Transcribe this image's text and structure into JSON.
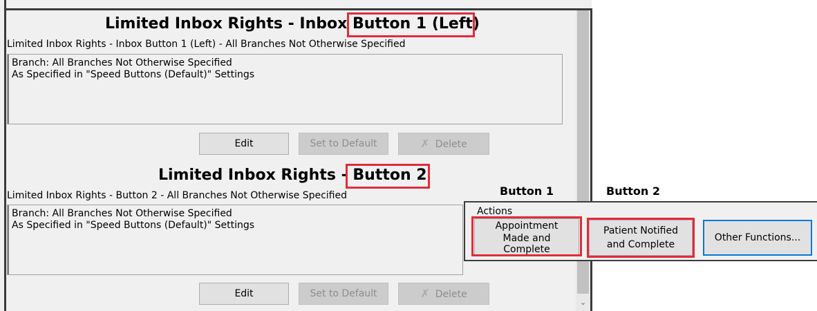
{
  "sections": [
    {
      "title_prefix": "Limited Inbox Rights - Inbox ",
      "title_highlight": "Button 1 (Left)",
      "subtitle": "Limited Inbox Rights - Inbox Button 1 (Left) - All Branches Not Otherwise Specified",
      "lines": [
        "Branch: All Branches Not Otherwise Specified",
        "As Specified in \"Speed Buttons (Default)\" Settings"
      ],
      "edit_label": "Edit",
      "default_label": "Set to Default",
      "delete_label": "Delete"
    },
    {
      "title_prefix": "Limited Inbox Rights - ",
      "title_highlight": "Button 2",
      "subtitle": "Limited Inbox Rights - Button 2 - All Branches Not Otherwise Specified",
      "lines": [
        "Branch: All Branches Not Otherwise Specified",
        "As Specified in \"Speed Buttons (Default)\" Settings"
      ],
      "edit_label": "Edit",
      "default_label": "Set to Default",
      "delete_label": "Delete"
    }
  ],
  "callouts": {
    "button1_label": "Button 1",
    "button2_label": "Button 2"
  },
  "actions": {
    "label": "Actions",
    "buttons": [
      {
        "line1": "Appointment",
        "line2": "Made and",
        "line3": "Complete"
      },
      {
        "line1": "Patient Notified",
        "line2": "and Complete"
      },
      {
        "line1": "Other Functions..."
      }
    ]
  },
  "colors": {
    "highlight": "#e02b3a",
    "focus": "#0078d7"
  }
}
